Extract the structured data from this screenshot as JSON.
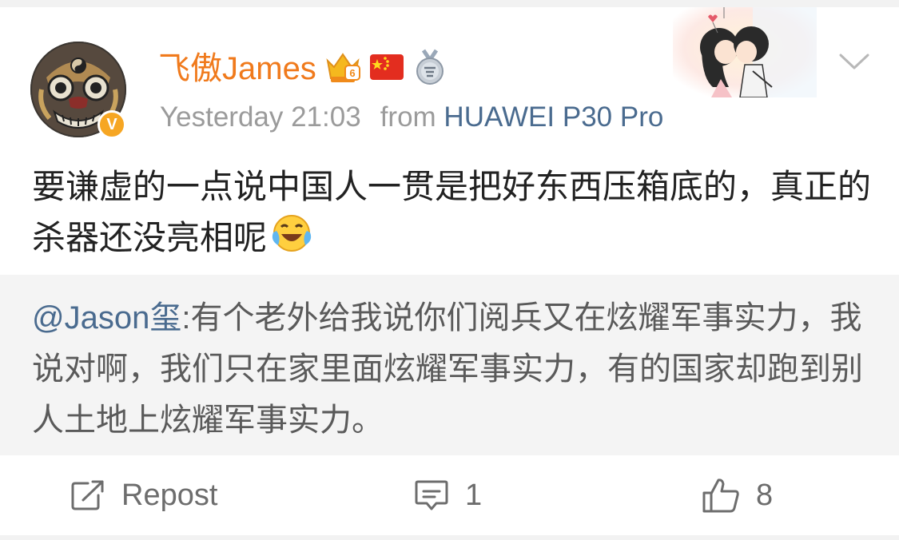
{
  "post": {
    "username": "飞傲James",
    "timestamp": "Yesterday 21:03",
    "from_label": "from",
    "device": "HUAWEI P30 Pro",
    "verified_badge": "V",
    "level_badge": "6",
    "content": "要谦虚的一点说中国人一贯是把好东西压箱底的，真正的杀器还没亮相呢",
    "emoji": "laughing-tears-emoji"
  },
  "quote": {
    "mention": "@Jason玺",
    "text": ":有个老外给我说你们阅兵又在炫耀军事实力，我说对啊，我们只在家里面炫耀军事实力，有的国家却跑到别人土地上炫耀军事实力。"
  },
  "actions": {
    "repost_label": "Repost",
    "comment_count": "1",
    "like_count": "8"
  },
  "icons": [
    "chevron-down-icon",
    "repost-icon",
    "comment-icon",
    "like-icon",
    "crown-icon",
    "china-flag-icon",
    "medal-icon"
  ],
  "colors": {
    "username": "#f07a1c",
    "link": "#4a6b8f",
    "verified": "#f6a623",
    "quote_bg": "#f4f4f4"
  }
}
